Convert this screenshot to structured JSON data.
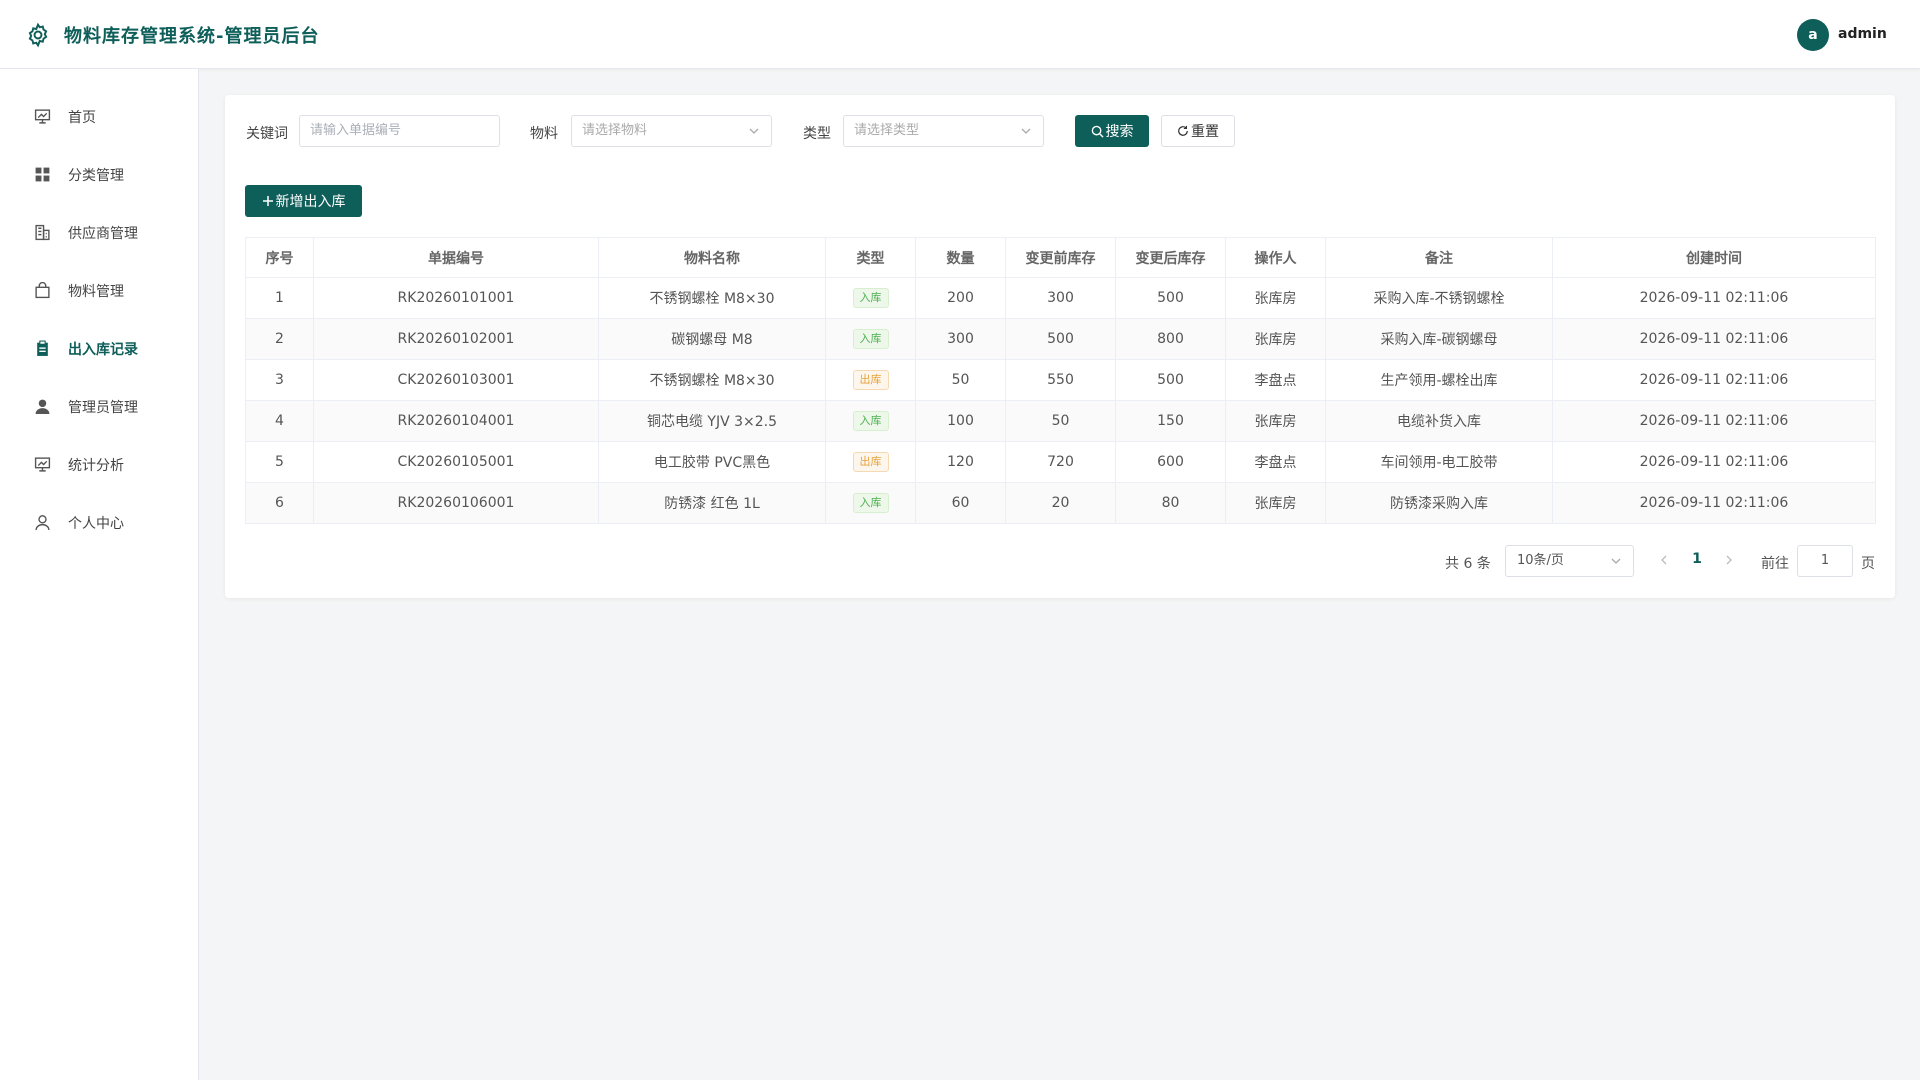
{
  "header": {
    "title": "物料库存管理系统-管理员后台",
    "avatar_letter": "a",
    "username": "admin"
  },
  "sidebar": {
    "items": [
      {
        "label": "首页",
        "icon": "dashboard-icon"
      },
      {
        "label": "分类管理",
        "icon": "grid-icon"
      },
      {
        "label": "供应商管理",
        "icon": "building-icon"
      },
      {
        "label": "物料管理",
        "icon": "bag-icon"
      },
      {
        "label": "出入库记录",
        "icon": "clipboard-icon",
        "active": true
      },
      {
        "label": "管理员管理",
        "icon": "user-fill-icon"
      },
      {
        "label": "统计分析",
        "icon": "chart-board-icon"
      },
      {
        "label": "个人中心",
        "icon": "user-icon"
      }
    ]
  },
  "filters": {
    "keyword_label": "关键词",
    "keyword_placeholder": "请输入单据编号",
    "material_label": "物料",
    "material_placeholder": "请选择物料",
    "type_label": "类型",
    "type_placeholder": "请选择类型",
    "search_label": "搜索",
    "reset_label": "重置"
  },
  "toolbar": {
    "add_label": "新增出入库"
  },
  "table": {
    "columns": [
      "序号",
      "单据编号",
      "物料名称",
      "类型",
      "数量",
      "变更前库存",
      "变更后库存",
      "操作人",
      "备注",
      "创建时间"
    ],
    "rows": [
      {
        "index": "1",
        "code": "RK20260101001",
        "material": "不锈钢螺栓 M8×30",
        "type": "入库",
        "type_kind": "in",
        "qty": "200",
        "before": "300",
        "after": "500",
        "operator": "张库房",
        "remark": "采购入库-不锈钢螺栓",
        "created": "2026-09-11 02:11:06"
      },
      {
        "index": "2",
        "code": "RK20260102001",
        "material": "碳钢螺母 M8",
        "type": "入库",
        "type_kind": "in",
        "qty": "300",
        "before": "500",
        "after": "800",
        "operator": "张库房",
        "remark": "采购入库-碳钢螺母",
        "created": "2026-09-11 02:11:06"
      },
      {
        "index": "3",
        "code": "CK20260103001",
        "material": "不锈钢螺栓 M8×30",
        "type": "出库",
        "type_kind": "out",
        "qty": "50",
        "before": "550",
        "after": "500",
        "operator": "李盘点",
        "remark": "生产领用-螺栓出库",
        "created": "2026-09-11 02:11:06"
      },
      {
        "index": "4",
        "code": "RK20260104001",
        "material": "铜芯电缆 YJV 3×2.5",
        "type": "入库",
        "type_kind": "in",
        "qty": "100",
        "before": "50",
        "after": "150",
        "operator": "张库房",
        "remark": "电缆补货入库",
        "created": "2026-09-11 02:11:06"
      },
      {
        "index": "5",
        "code": "CK20260105001",
        "material": "电工胶带 PVC黑色",
        "type": "出库",
        "type_kind": "out",
        "qty": "120",
        "before": "720",
        "after": "600",
        "operator": "李盘点",
        "remark": "车间领用-电工胶带",
        "created": "2026-09-11 02:11:06"
      },
      {
        "index": "6",
        "code": "RK20260106001",
        "material": "防锈漆 红色 1L",
        "type": "入库",
        "type_kind": "in",
        "qty": "60",
        "before": "20",
        "after": "80",
        "operator": "张库房",
        "remark": "防锈漆采购入库",
        "created": "2026-09-11 02:11:06"
      }
    ]
  },
  "pagination": {
    "total_text": "共 6 条",
    "page_size": "10条/页",
    "current_page": "1",
    "goto_label": "前往",
    "goto_value": "1",
    "page_unit": "页"
  },
  "colors": {
    "primary": "#0e5e5a",
    "tag_in": "#4caf50",
    "tag_out": "#e6a23c"
  }
}
